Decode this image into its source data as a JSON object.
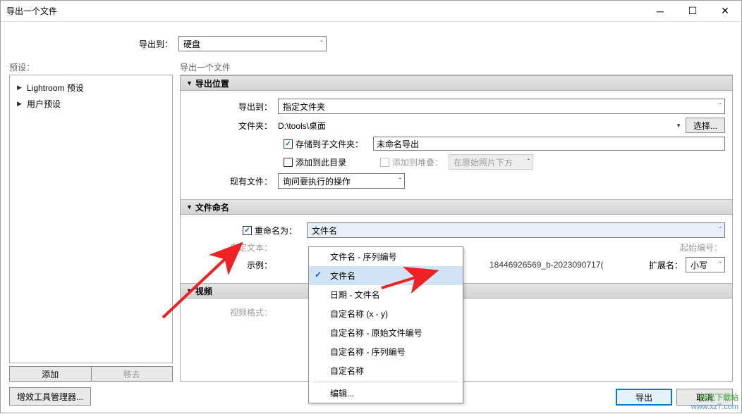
{
  "title": "导出一个文件",
  "exportToLabel": "导出到：",
  "exportToValue": "硬盘",
  "presets": {
    "header": "预设：",
    "items": [
      "Lightroom 预设",
      "用户预设"
    ],
    "addBtn": "添加",
    "removeBtn": "移去"
  },
  "rightHeader": "导出一个文件",
  "sections": {
    "location": {
      "title": "导出位置",
      "exportToLabel": "导出到：",
      "exportToValue": "指定文件夹",
      "folderLabel": "文件夹：",
      "folderPath": "D:\\tools\\桌面",
      "chooseBtn": "选择...",
      "storeSub": "存储到子文件夹：",
      "subfolderValue": "未命名导出",
      "addCatalog": "添加到此目录",
      "addStack": "添加到堆叠：",
      "stackValue": "在原始照片下方",
      "existingLabel": "现有文件：",
      "existingValue": "询问要执行的操作"
    },
    "naming": {
      "title": "文件命名",
      "renameLabel": "重命名为：",
      "renameValue": "文件名",
      "customTextLabel": "自定文本：",
      "startNumLabel": "起始编号：",
      "exampleLabel": "示例：",
      "exampleValue": "18446926569_b-2023090717(",
      "extLabel": "扩展名：",
      "extValue": "小写"
    },
    "video": {
      "title": "视频",
      "formatLabel": "视频格式："
    }
  },
  "popup": {
    "items": [
      "文件名 - 序列编号",
      "文件名",
      "日期 - 文件名",
      "自定名称 (x - y)",
      "自定名称 - 原始文件编号",
      "自定名称 - 序列编号",
      "自定名称"
    ],
    "editItem": "编辑..."
  },
  "pluginBtn": "增效工具管理器...",
  "exportBtn": "导出",
  "cancelBtn": "取消",
  "watermark1": "极光下载站",
  "watermark2": "www.xz7.com"
}
